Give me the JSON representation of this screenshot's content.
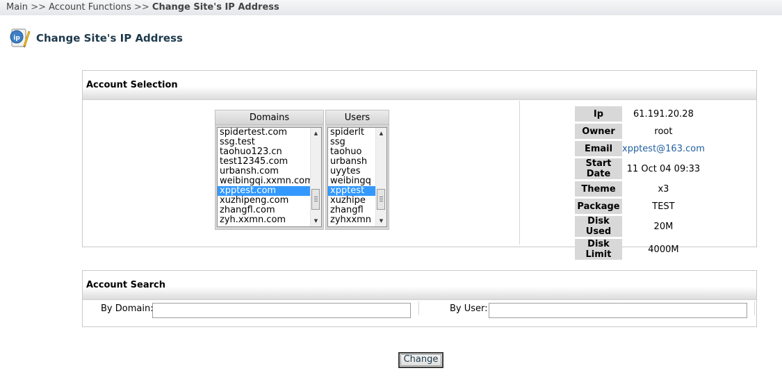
{
  "breadcrumb": {
    "items": [
      "Main",
      "Account Functions"
    ],
    "separator": ">>",
    "current": "Change Site's IP Address"
  },
  "page": {
    "title": "Change Site's IP Address",
    "icon": "ip-address-icon"
  },
  "account_selection": {
    "header": "Account Selection",
    "domains": {
      "header": "Domains",
      "items": [
        "spidertest.com",
        "ssg.test",
        "taohuo123.cn",
        "test12345.com",
        "urbansh.com",
        "weibingqi.xxmn.com",
        "xpptest.com",
        "xuzhipeng.com",
        "zhangfl.com",
        "zyh.xxmn.com"
      ],
      "selected": "xpptest.com"
    },
    "users": {
      "header": "Users",
      "items": [
        "spiderlt",
        "ssg",
        "taohuo",
        "urbansh",
        "uyytes",
        "weibingq",
        "xpptest",
        "xuzhipe",
        "zhangfl",
        "zyhxxmn"
      ],
      "selected": "xpptest"
    },
    "info": {
      "ip_label": "Ip",
      "ip": "61.191.20.28",
      "owner_label": "Owner",
      "owner": "root",
      "email_label": "Email",
      "email": "xpptest@163.com",
      "start_date_label": "Start Date",
      "start_date": "11 Oct 04 09:33",
      "theme_label": "Theme",
      "theme": "x3",
      "package_label": "Package",
      "package": "TEST",
      "disk_used_label": "Disk Used",
      "disk_used": "20M",
      "disk_limit_label": "Disk Limit",
      "disk_limit": "4000M"
    }
  },
  "account_search": {
    "header": "Account Search",
    "by_domain_label": "By Domain:",
    "by_domain_value": "",
    "by_user_label": "By User:",
    "by_user_value": ""
  },
  "actions": {
    "change_label": "Change"
  },
  "colors": {
    "selection": "#3399ff",
    "title": "#1d3a4c",
    "link": "#1f5f9f"
  }
}
